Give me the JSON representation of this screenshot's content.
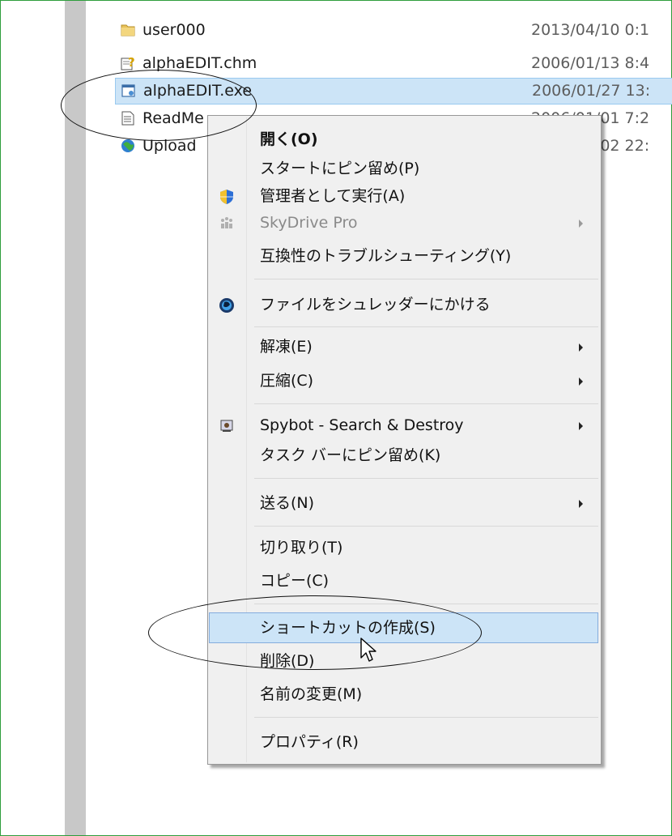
{
  "files": [
    {
      "name": "user000",
      "date": "2013/04/10 0:1",
      "icon": "folder-icon"
    },
    {
      "name": "alphaEDIT.chm",
      "date": "2006/01/13 8:4",
      "icon": "help-file-icon"
    },
    {
      "name": "alphaEDIT.exe",
      "date": "2006/01/27 13:",
      "icon": "exe-icon",
      "selected": true
    },
    {
      "name": "ReadMe",
      "date": "2006/01/01 7:2",
      "icon": "text-file-icon"
    },
    {
      "name": "Upload",
      "date": "2006/01/02 22:",
      "icon": "globe-icon"
    }
  ],
  "menu": {
    "open": "開く(O)",
    "pin_start": "スタートにピン留め(P)",
    "run_as_admin": "管理者として実行(A)",
    "skydrive_pro": "SkyDrive Pro",
    "compat_troubleshoot": "互換性のトラブルシューティング(Y)",
    "shredder": "ファイルをシュレッダーにかける",
    "extract": "解凍(E)",
    "compress": "圧縮(C)",
    "spybot": "Spybot - Search & Destroy",
    "pin_taskbar": "タスク バーにピン留め(K)",
    "send_to": "送る(N)",
    "cut": "切り取り(T)",
    "copy": "コピー(C)",
    "create_shortcut": "ショートカットの作成(S)",
    "delete": "削除(D)",
    "rename": "名前の変更(M)",
    "properties": "プロパティ(R)"
  },
  "colors": {
    "selection": "#cce4f7",
    "selection_border": "#84acdd",
    "frame_border": "#2e9e3c"
  }
}
